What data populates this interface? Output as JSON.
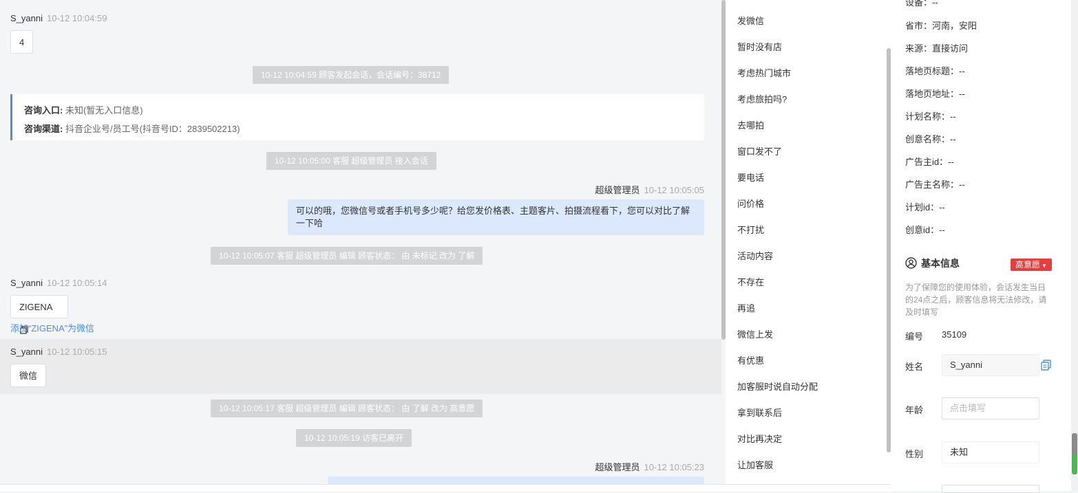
{
  "chat": {
    "messages": [
      {
        "sender": "S_yanni",
        "time": "10-12 10:04:59",
        "text": "4"
      },
      {
        "sender": "S_yanni",
        "time": "10-12 10:05:14",
        "text": "ZIGENA",
        "link": "添加“ZIGENA”为微信"
      },
      {
        "sender": "S_yanni",
        "time": "10-12 10:05:15",
        "text": "微信"
      }
    ],
    "system": [
      "10-12 10:04:59 顾客发起会话，会话编号：38712",
      "10-12 10:05:00 客服 超级管理员 接入会话",
      "10-12 10:05:07 客服 超级管理员 编辑 顾客状态： 由 未标记 改为 了解",
      "10-12 10:05:17 客服 超级管理员 编辑 顾客状态： 由 了解 改为 高意愿",
      "10-12 10:05:19 访客已离开"
    ],
    "consult": {
      "entry_label": "咨询入口:",
      "entry_value": "未知(暂无入口信息)",
      "channel_label": "咨询渠道:",
      "channel_value": "抖音企业号/员工号(抖音号ID：2839502213)"
    },
    "agent": [
      {
        "name": "超级管理员",
        "time": "10-12 10:05:05",
        "text": "可以的哦，您微信号或者手机号多少呢？给您发价格表、主题客片、拍摄流程看下，您可以对比了解一下哈"
      },
      {
        "name": "超级管理员",
        "time": "10-12 10:05:23"
      }
    ]
  },
  "quick_replies": [
    "发微信",
    "暂时没有店",
    "考虑热门城市",
    "考虑旅拍吗?",
    "去哪拍",
    "窗口发不了",
    "要电话",
    "问价格",
    "不打扰",
    "活动内容",
    "不存在",
    "再追",
    "微信上发",
    "有优惠",
    "加客服时说自动分配",
    "拿到联系后",
    "对比再决定",
    "让加客服"
  ],
  "info": {
    "top_rows": [
      "设备：--",
      "省市：河南，安阳",
      "来源：直接访问",
      "落地页标题：--",
      "落地页地址：--",
      "计划名称：--",
      "创意名称：--",
      "广告主id：--",
      "广告主名称：--",
      "计划id：--",
      "创意id：--"
    ],
    "basic_title": "基本信息",
    "tag": "高意愿",
    "note": "为了保障您的使用体验，会话发生当日的24点之后，顾客信息将无法修改，请及时填写",
    "id_label": "编号",
    "id_value": "35109",
    "name_label": "姓名",
    "name_value": "S_yanni",
    "age_label": "年龄",
    "age_placeholder": "点击填写",
    "gender_label": "性别",
    "gender_value": "未知"
  }
}
